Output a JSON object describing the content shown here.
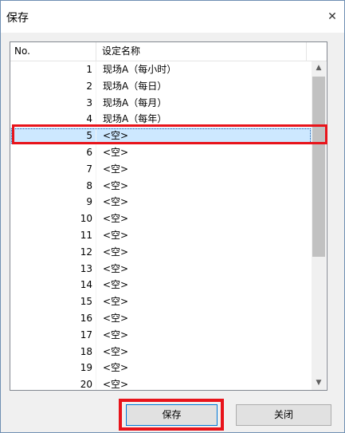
{
  "window": {
    "title": "保存",
    "close_glyph": "✕"
  },
  "list": {
    "columns": {
      "no": "No.",
      "name": "设定名称"
    },
    "rows": [
      {
        "no": "1",
        "name": "现场A（每小时）"
      },
      {
        "no": "2",
        "name": "现场A（每日）"
      },
      {
        "no": "3",
        "name": "现场A（每月）"
      },
      {
        "no": "4",
        "name": "现场A（每年）"
      },
      {
        "no": "5",
        "name": "<空>"
      },
      {
        "no": "6",
        "name": "<空>"
      },
      {
        "no": "7",
        "name": "<空>"
      },
      {
        "no": "8",
        "name": "<空>"
      },
      {
        "no": "9",
        "name": "<空>"
      },
      {
        "no": "10",
        "name": "<空>"
      },
      {
        "no": "11",
        "name": "<空>"
      },
      {
        "no": "12",
        "name": "<空>"
      },
      {
        "no": "13",
        "name": "<空>"
      },
      {
        "no": "14",
        "name": "<空>"
      },
      {
        "no": "15",
        "name": "<空>"
      },
      {
        "no": "16",
        "name": "<空>"
      },
      {
        "no": "17",
        "name": "<空>"
      },
      {
        "no": "18",
        "name": "<空>"
      },
      {
        "no": "19",
        "name": "<空>"
      },
      {
        "no": "20",
        "name": "<空>"
      }
    ],
    "selected_row": "5",
    "scroll": {
      "up_glyph": "▲",
      "down_glyph": "▼"
    }
  },
  "buttons": {
    "save": "保存",
    "close": "关闭"
  },
  "colors": {
    "highlight": "#e8141b",
    "selection": "#cde8ff"
  }
}
